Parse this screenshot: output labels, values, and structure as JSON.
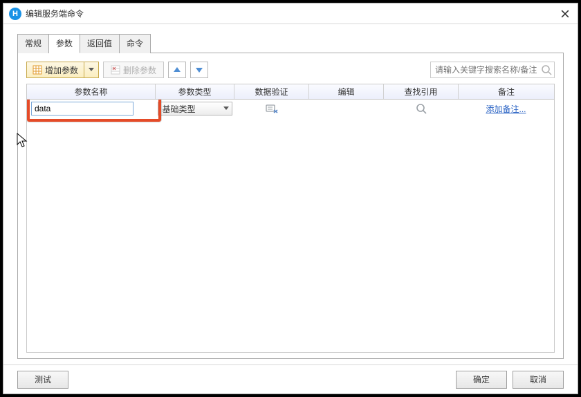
{
  "window": {
    "title": "编辑服务端命令"
  },
  "tabs": [
    "常规",
    "参数",
    "返回值",
    "命令"
  ],
  "active_tab_index": 1,
  "toolbar": {
    "add_param": "增加参数",
    "del_param": "删除参数"
  },
  "search": {
    "placeholder": "请输入关键字搜索名称/备注"
  },
  "columns": {
    "name": "参数名称",
    "type": "参数类型",
    "valid": "数据验证",
    "edit": "编辑",
    "find": "查找引用",
    "note": "备注"
  },
  "row": {
    "name": "data",
    "type": "基础类型",
    "note_link": "添加备注..."
  },
  "footer": {
    "test": "测试",
    "ok": "确定",
    "cancel": "取消"
  }
}
